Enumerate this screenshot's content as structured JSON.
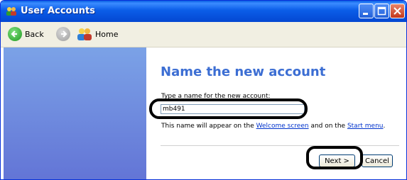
{
  "window": {
    "title": "User Accounts"
  },
  "toolbar": {
    "back_label": "Back",
    "home_label": "Home"
  },
  "content": {
    "heading": "Name the new account",
    "prompt": "Type a name for the new account:",
    "name_value": "mb491",
    "hint_before": "This name will appear on the ",
    "hint_link1": "Welcome screen",
    "hint_middle": " and on the ",
    "hint_link2": "Start menu",
    "hint_after": ".",
    "next_label": "Next >",
    "cancel_label": "Cancel"
  },
  "colors": {
    "accent_blue": "#3c6ed3",
    "titlebar": "#0447d2",
    "sidebar": "#6375d6",
    "link": "#0033cc"
  }
}
